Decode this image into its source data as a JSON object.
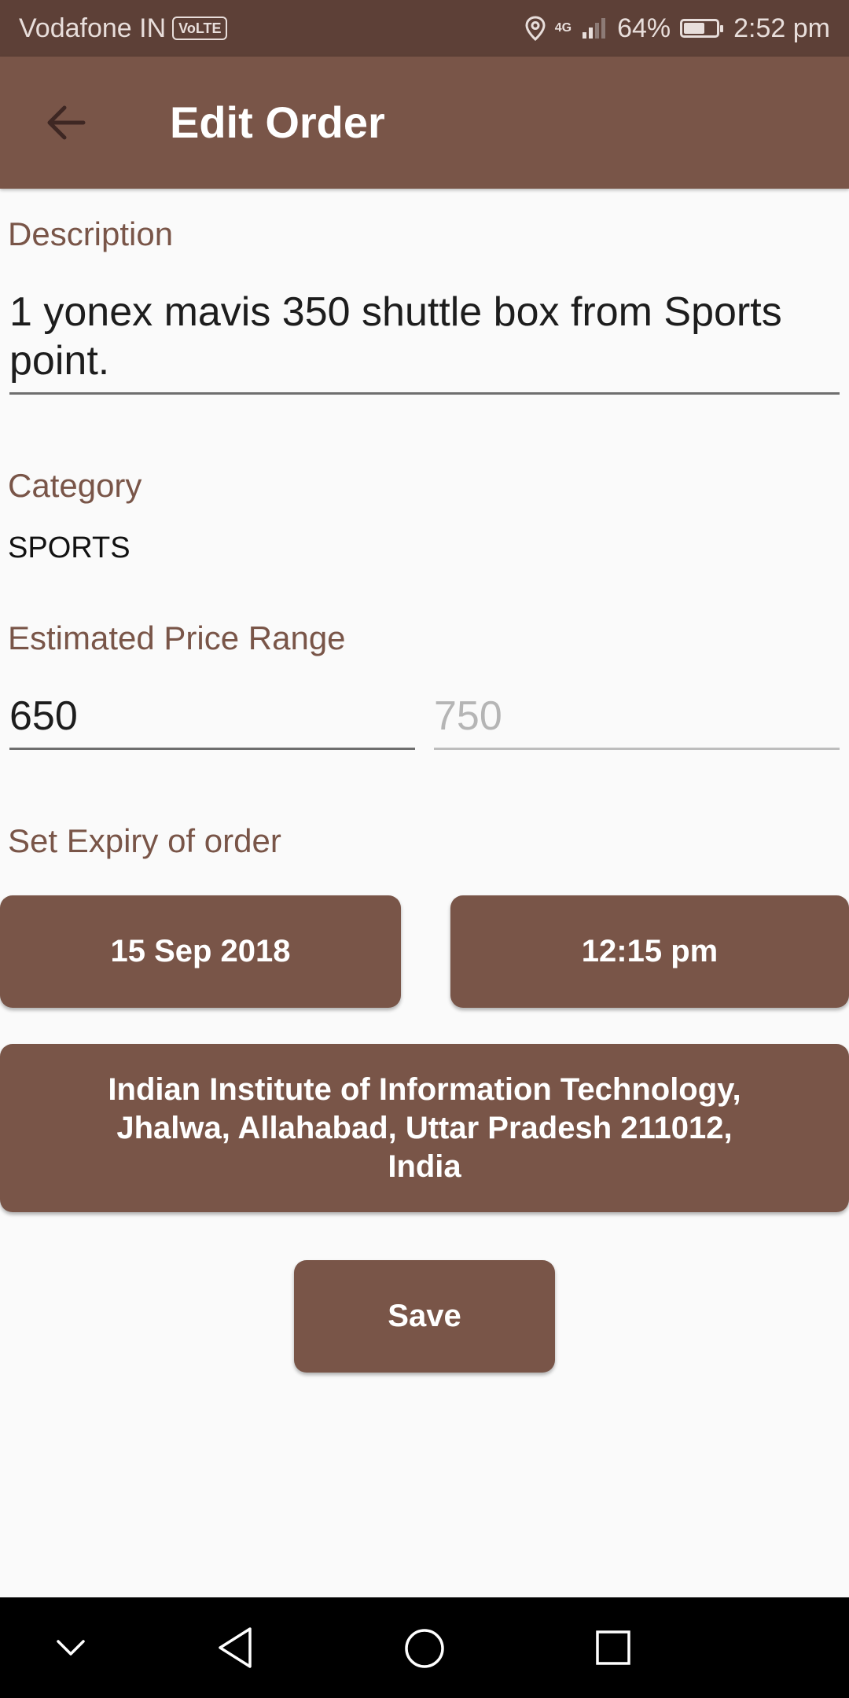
{
  "status_bar": {
    "carrier": "Vodafone IN",
    "volte": "VoLTE",
    "network": "4G",
    "battery_percent": "64%",
    "battery_level": 0.64,
    "time": "2:52 pm"
  },
  "app_bar": {
    "title": "Edit Order",
    "back_icon": "arrow-back-icon"
  },
  "description": {
    "label": "Description",
    "value": "1 yonex mavis 350 shuttle box from Sports point."
  },
  "category": {
    "label": "Category",
    "value": "SPORTS"
  },
  "price_range": {
    "label": "Estimated Price Range",
    "min_value": "650",
    "max_placeholder": "750"
  },
  "expiry": {
    "label": "Set Expiry of order",
    "date": "15 Sep 2018",
    "time": "12:15 pm"
  },
  "location": {
    "address": "Indian Institute of Information Technology, Jhalwa, Allahabad, Uttar Pradesh 211012, India"
  },
  "save_button": "Save",
  "colors": {
    "primary": "#795548",
    "primary_dark": "#5d4037",
    "background": "#fafafa"
  },
  "nav_bar": {
    "icons": [
      "chevron-down-icon",
      "back-triangle-icon",
      "home-circle-icon",
      "recents-square-icon"
    ]
  }
}
